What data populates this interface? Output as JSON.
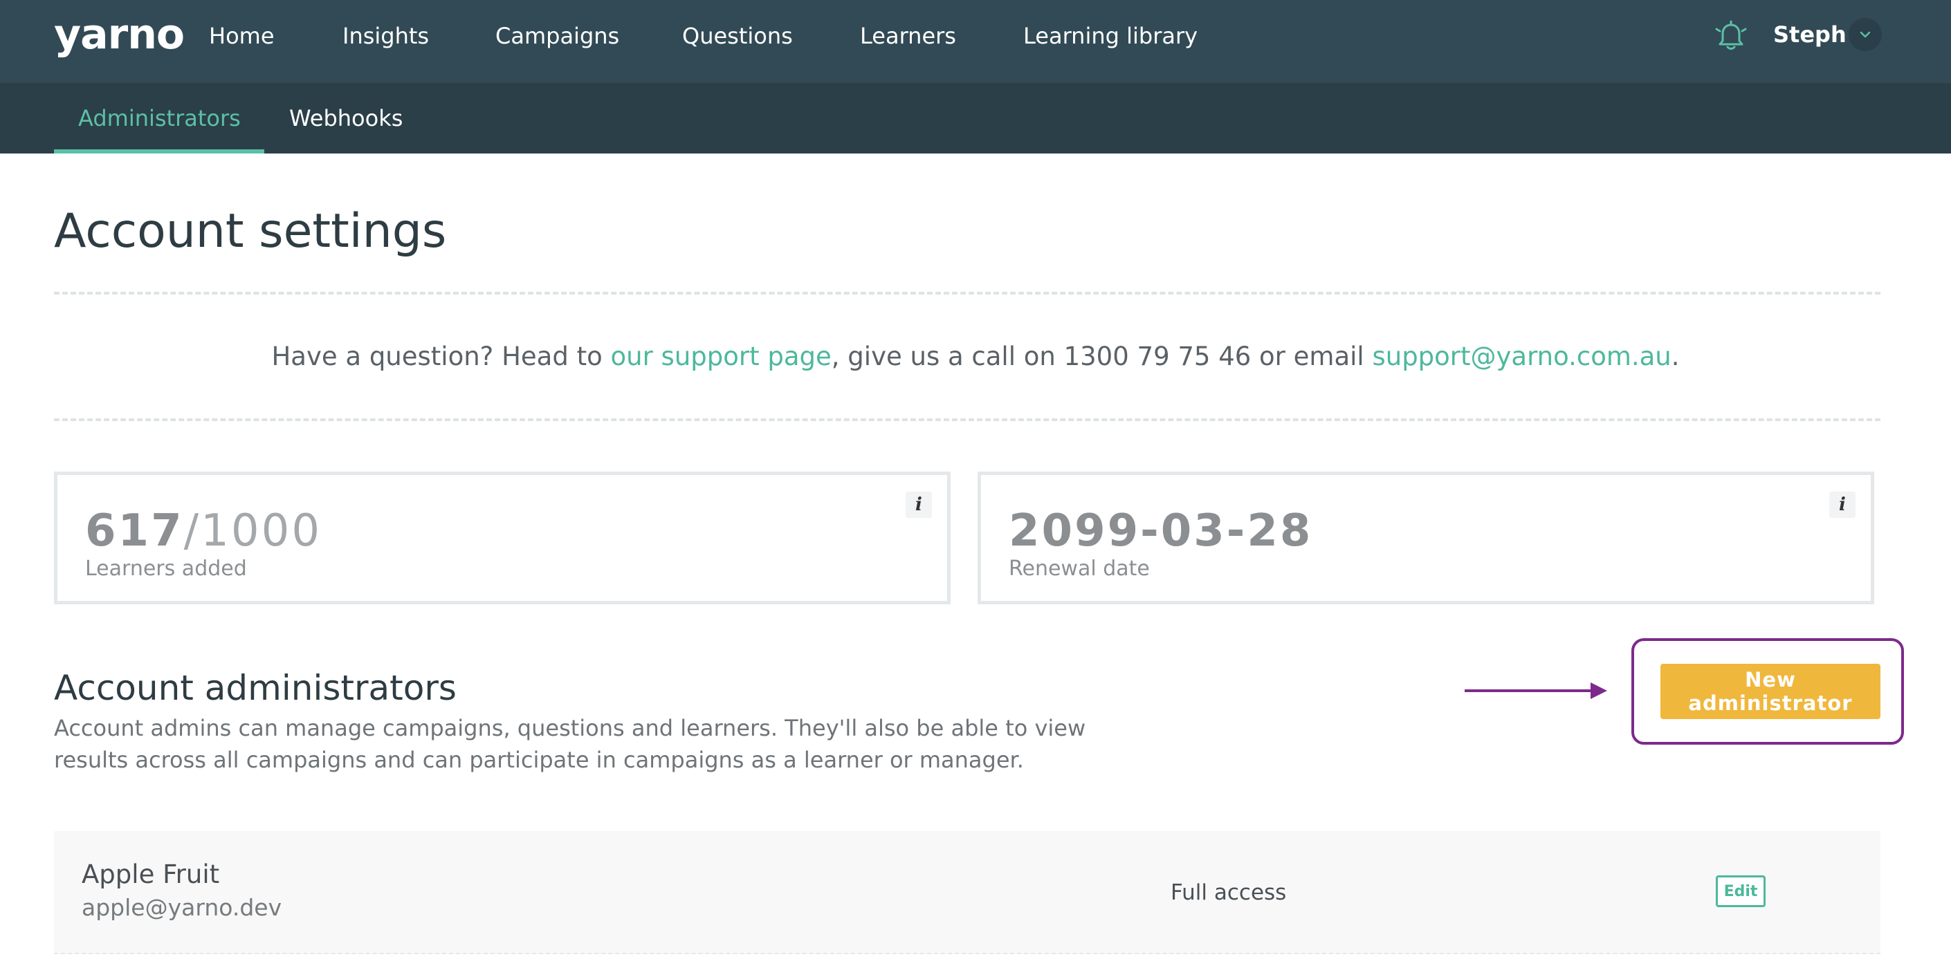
{
  "app": {
    "logo": "yarno",
    "nav": [
      {
        "label": "Home"
      },
      {
        "label": "Insights"
      },
      {
        "label": "Campaigns"
      },
      {
        "label": "Questions"
      },
      {
        "label": "Learners"
      },
      {
        "label": "Learning library"
      }
    ],
    "user": {
      "name": "Steph",
      "notification_icon": "bell-icon",
      "menu_icon": "chevron-down-icon"
    }
  },
  "subnav": {
    "tabs": [
      {
        "label": "Administrators",
        "active": true
      },
      {
        "label": "Webhooks",
        "active": false
      }
    ]
  },
  "page": {
    "title": "Account settings",
    "support": {
      "prefix": "Have a question? Head to ",
      "support_link": "our support page",
      "middle": ", give us a call on 1300 79 75 46 or email ",
      "email_link": "support@yarno.com.au",
      "suffix": "."
    },
    "stats": {
      "learners": {
        "value": "617",
        "total": "/1000",
        "label": "Learners added",
        "info_icon": "i"
      },
      "renewal": {
        "value": "2099-03-28",
        "label": "Renewal date",
        "info_icon": "i"
      }
    },
    "admins_section": {
      "title": "Account administrators",
      "description": "Account admins can manage campaigns, questions and learners. They'll also be able to view results across all campaigns and can participate in campaigns as a learner or manager.",
      "new_button_label": "New administrator"
    },
    "admins": [
      {
        "name": "Apple Fruit",
        "email": "apple@yarno.dev",
        "access": "Full access",
        "edit_label": "Edit"
      }
    ]
  },
  "colors": {
    "nav_bg": "#324a55",
    "subnav_bg": "#2b3f48",
    "accent_green": "#5cc0a6",
    "button_yellow": "#f0b73d",
    "annotation_purple": "#7d2a8c"
  }
}
